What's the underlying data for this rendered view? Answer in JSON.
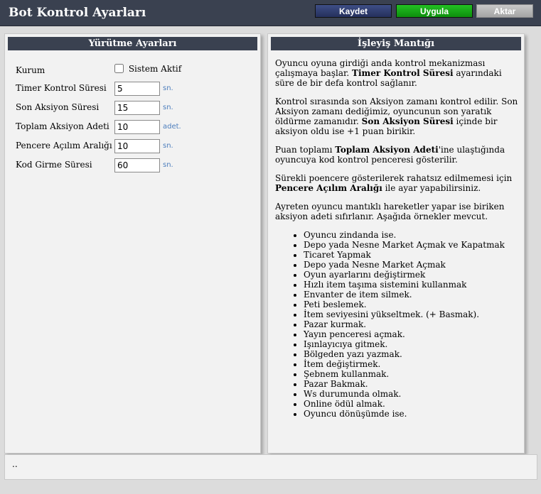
{
  "window": {
    "title": "Bot Kontrol Ayarları"
  },
  "toolbar": {
    "save_label": "Kaydet",
    "apply_label": "Uygula",
    "toggle_label": "Aktar"
  },
  "left_panel": {
    "title": "Yürütme Ayarları",
    "status_label": "Kurum",
    "checkbox_label": "Sistem Aktif",
    "checkbox_checked": false,
    "fields": [
      {
        "label": "Timer Kontrol Süresi",
        "value": "5",
        "unit": "sn."
      },
      {
        "label": "Son Aksiyon Süresi",
        "value": "15",
        "unit": "sn."
      },
      {
        "label": "Toplam Aksiyon Adeti",
        "value": "10",
        "unit": "adet."
      },
      {
        "label": "Pencere Açılım Aralığı",
        "value": "10",
        "unit": "sn."
      },
      {
        "label": "Kod Girme Süresi",
        "value": "60",
        "unit": "sn."
      }
    ]
  },
  "right_panel": {
    "title": "İşleyiş Mantığı",
    "p1_a": "Oyuncu oyuna girdiği anda kontrol mekanizması çalışmaya başlar. ",
    "p1_b": "Timer Kontrol Süresi",
    "p1_c": " ayarındaki süre de bir defa kontrol sağlanır.",
    "p2_a": "Kontrol sırasında son Aksiyon zamanı kontrol edilir. Son Aksiyon zamanı dediğimiz, oyuncunun son yaratık öldürme zamanıdır. ",
    "p2_b": "Son Aksiyon Süresi",
    "p2_c": " içinde bir aksiyon oldu ise +1 puan birikir.",
    "p3_a": "Puan toplamı ",
    "p3_b": "Toplam Aksiyon Adeti",
    "p3_c": "'ine ulaştığında oyuncuya kod kontrol penceresi gösterilir.",
    "p4_a": "Sürekli poencere gösterilerek rahatsız edilmemesi için ",
    "p4_b": "Pencere Açılım Aralığı",
    "p4_c": " ile ayar yapabilirsiniz.",
    "p5": "Ayreten oyuncu mantıklı hareketler yapar ise biriken aksiyon adeti sıfırlanır. Aşağıda örnekler mevcut.",
    "items": [
      "Oyuncu zindanda ise.",
      "Depo yada Nesne Market Açmak ve Kapatmak",
      "Ticaret Yapmak",
      "Depo yada Nesne Market Açmak",
      "Oyun ayarlarını değiştirmek",
      "Hızlı item taşıma sistemini kullanmak",
      "Envanter de item silmek.",
      "Peti beslemek.",
      "İtem seviyesini yükseltmek. (+ Basmak).",
      "Pazar kurmak.",
      "Yayın penceresi açmak.",
      "Işınlayıcıya gitmek.",
      "Bölgeden yazı yazmak.",
      "İtem değiştirmek.",
      "Şebnem kullanmak.",
      "Pazar Bakmak.",
      "Ws durumunda olmak.",
      "Online ödül almak.",
      "Oyuncu dönüşümde ise."
    ]
  },
  "status_bar": {
    "text": ".."
  }
}
